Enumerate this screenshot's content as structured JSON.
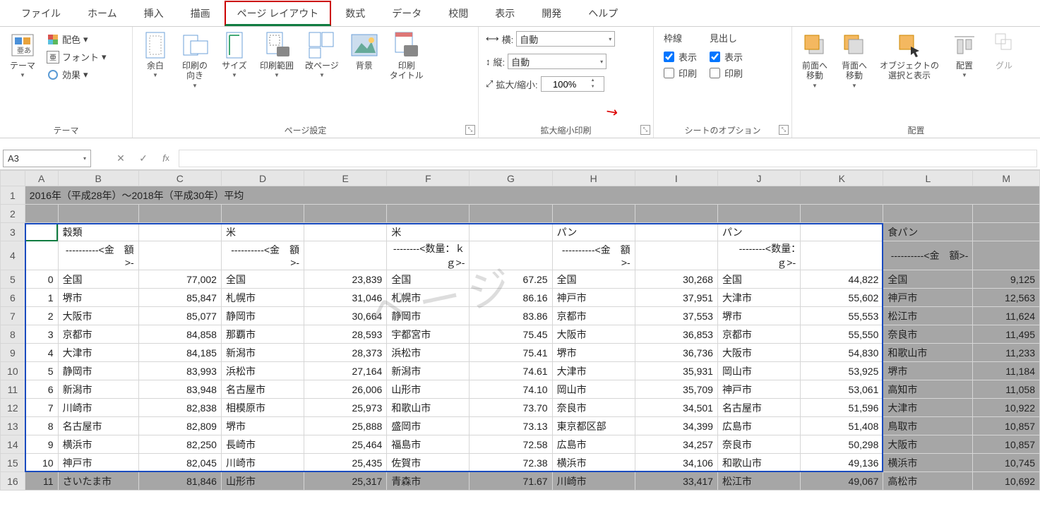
{
  "tabs": [
    "ファイル",
    "ホーム",
    "挿入",
    "描画",
    "ページ レイアウト",
    "数式",
    "データ",
    "校閲",
    "表示",
    "開発",
    "ヘルプ"
  ],
  "active_tab_index": 4,
  "ribbon": {
    "theme": {
      "label": "テーマ",
      "themes": "テーマ",
      "colors": "配色",
      "fonts": "フォント",
      "effects": "効果"
    },
    "page": {
      "label": "ページ設定",
      "margins": "余白",
      "orientation": "印刷の\n向き",
      "size": "サイズ",
      "print_area": "印刷範囲",
      "breaks": "改ページ",
      "background": "背景",
      "titles": "印刷\nタイトル"
    },
    "scale": {
      "label": "拡大縮小印刷",
      "width": "横:",
      "height": "縦:",
      "auto": "自動",
      "scale_lbl": "拡大/縮小:",
      "scale_val": "100%"
    },
    "sheetopt": {
      "label": "シートのオプション",
      "gridlines": "枠線",
      "headings": "見出し",
      "view": "表示",
      "print": "印刷"
    },
    "arrange": {
      "label": "配置",
      "front": "前面へ\n移動",
      "back": "背面へ\n移動",
      "selpane": "オブジェクトの\n選択と表示",
      "align": "配置",
      "group": "グル"
    }
  },
  "namebox": "A3",
  "colheaders": [
    "A",
    "B",
    "C",
    "D",
    "E",
    "F",
    "G",
    "H",
    "I",
    "J",
    "K",
    "L",
    "M"
  ],
  "title_row": "2016年（平成28年）～2018年（平成30年）平均",
  "header1": [
    "",
    "穀類",
    "",
    "米",
    "",
    "米",
    "",
    "パン",
    "",
    "パン",
    "",
    "食パン",
    ""
  ],
  "header2": [
    "",
    "----------<金　額>-",
    "",
    "----------<金　額>-",
    "",
    "--------<数量：ｋｇ>-",
    "",
    "----------<金　額>-",
    "",
    "--------<数量：　ｇ>-",
    "",
    "----------<金　額>-",
    ""
  ],
  "rows": [
    {
      "n": "0",
      "a": [
        "全国",
        "77,002",
        "全国",
        "23,839",
        "全国",
        "67.25",
        "全国",
        "30,268",
        "全国",
        "44,822",
        "全国",
        "9,125"
      ]
    },
    {
      "n": "1",
      "a": [
        "堺市",
        "85,847",
        "札幌市",
        "31,046",
        "札幌市",
        "86.16",
        "神戸市",
        "37,951",
        "大津市",
        "55,602",
        "神戸市",
        "12,563"
      ]
    },
    {
      "n": "2",
      "a": [
        "大阪市",
        "85,077",
        "静岡市",
        "30,664",
        "静岡市",
        "83.86",
        "京都市",
        "37,553",
        "堺市",
        "55,553",
        "松江市",
        "11,624"
      ]
    },
    {
      "n": "3",
      "a": [
        "京都市",
        "84,858",
        "那覇市",
        "28,593",
        "宇都宮市",
        "75.45",
        "大阪市",
        "36,853",
        "京都市",
        "55,550",
        "奈良市",
        "11,495"
      ]
    },
    {
      "n": "4",
      "a": [
        "大津市",
        "84,185",
        "新潟市",
        "28,373",
        "浜松市",
        "75.41",
        "堺市",
        "36,736",
        "大阪市",
        "54,830",
        "和歌山市",
        "11,233"
      ]
    },
    {
      "n": "5",
      "a": [
        "静岡市",
        "83,993",
        "浜松市",
        "27,164",
        "新潟市",
        "74.61",
        "大津市",
        "35,931",
        "岡山市",
        "53,925",
        "堺市",
        "11,184"
      ]
    },
    {
      "n": "6",
      "a": [
        "新潟市",
        "83,948",
        "名古屋市",
        "26,006",
        "山形市",
        "74.10",
        "岡山市",
        "35,709",
        "神戸市",
        "53,061",
        "高知市",
        "11,058"
      ]
    },
    {
      "n": "7",
      "a": [
        "川崎市",
        "82,838",
        "相模原市",
        "25,973",
        "和歌山市",
        "73.70",
        "奈良市",
        "34,501",
        "名古屋市",
        "51,596",
        "大津市",
        "10,922"
      ]
    },
    {
      "n": "8",
      "a": [
        "名古屋市",
        "82,809",
        "堺市",
        "25,888",
        "盛岡市",
        "73.13",
        "東京都区部",
        "34,399",
        "広島市",
        "51,408",
        "鳥取市",
        "10,857"
      ]
    },
    {
      "n": "9",
      "a": [
        "横浜市",
        "82,250",
        "長崎市",
        "25,464",
        "福島市",
        "72.58",
        "広島市",
        "34,257",
        "奈良市",
        "50,298",
        "大阪市",
        "10,857"
      ]
    },
    {
      "n": "10",
      "a": [
        "神戸市",
        "82,045",
        "川崎市",
        "25,435",
        "佐賀市",
        "72.38",
        "横浜市",
        "34,106",
        "和歌山市",
        "49,136",
        "横浜市",
        "10,745"
      ]
    },
    {
      "n": "11",
      "a": [
        "さいたま市",
        "81,846",
        "山形市",
        "25,317",
        "青森市",
        "71.67",
        "川崎市",
        "33,417",
        "松江市",
        "49,067",
        "高松市",
        "10,692"
      ]
    }
  ],
  "watermark": "ページ"
}
